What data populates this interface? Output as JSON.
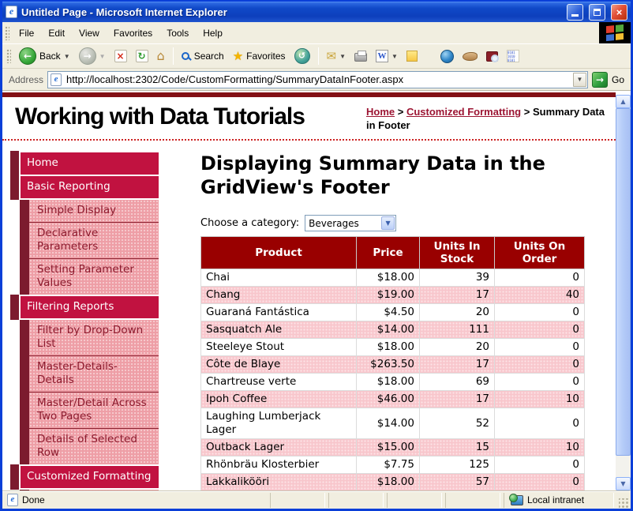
{
  "window": {
    "title": "Untitled Page - Microsoft Internet Explorer"
  },
  "menu": {
    "items": [
      "File",
      "Edit",
      "View",
      "Favorites",
      "Tools",
      "Help"
    ]
  },
  "toolbar": {
    "back_label": "Back",
    "search_label": "Search",
    "favorites_label": "Favorites"
  },
  "address": {
    "label": "Address",
    "value": "http://localhost:2302/Code/CustomFormatting/SummaryDataInFooter.aspx",
    "go_label": "Go"
  },
  "masthead": {
    "title": "Working with Data Tutorials",
    "separator": ">",
    "breadcrumb": [
      {
        "label": "Home",
        "link": true
      },
      {
        "label": "Customized Formatting",
        "link": true
      },
      {
        "label": "Summary Data in Footer",
        "link": false
      }
    ]
  },
  "sidebar": {
    "items": [
      {
        "label": "Home",
        "level": 1
      },
      {
        "label": "Basic Reporting",
        "level": 1
      },
      {
        "label": "Simple Display",
        "level": 2
      },
      {
        "label": "Declarative Parameters",
        "level": 2
      },
      {
        "label": "Setting Parameter Values",
        "level": 2
      },
      {
        "label": "Filtering Reports",
        "level": 1
      },
      {
        "label": "Filter by Drop-Down List",
        "level": 2
      },
      {
        "label": "Master-Details-Details",
        "level": 2
      },
      {
        "label": "Master/Detail Across Two Pages",
        "level": 2
      },
      {
        "label": "Details of Selected Row",
        "level": 2
      },
      {
        "label": "Customized Formatting",
        "level": 1
      }
    ]
  },
  "main": {
    "heading": "Displaying Summary Data in the GridView's Footer",
    "category_label": "Choose a category:",
    "category_value": "Beverages",
    "table": {
      "columns": [
        "Product",
        "Price",
        "Units In Stock",
        "Units On Order"
      ],
      "rows": [
        [
          "Chai",
          "$18.00",
          "39",
          "0"
        ],
        [
          "Chang",
          "$19.00",
          "17",
          "40"
        ],
        [
          "Guaraná Fantástica",
          "$4.50",
          "20",
          "0"
        ],
        [
          "Sasquatch Ale",
          "$14.00",
          "111",
          "0"
        ],
        [
          "Steeleye Stout",
          "$18.00",
          "20",
          "0"
        ],
        [
          "Côte de Blaye",
          "$263.50",
          "17",
          "0"
        ],
        [
          "Chartreuse verte",
          "$18.00",
          "69",
          "0"
        ],
        [
          "Ipoh Coffee",
          "$46.00",
          "17",
          "10"
        ],
        [
          "Laughing Lumberjack Lager",
          "$14.00",
          "52",
          "0"
        ],
        [
          "Outback Lager",
          "$15.00",
          "15",
          "10"
        ],
        [
          "Rhönbräu Klosterbier",
          "$7.75",
          "125",
          "0"
        ],
        [
          "Lakkalikööri",
          "$18.00",
          "57",
          "0"
        ]
      ]
    }
  },
  "statusbar": {
    "status": "Done",
    "zone": "Local intranet"
  },
  "colors": {
    "table_header_bg": "#990000",
    "row_pink": "#f8c6cc",
    "nav_crimson": "#c11240",
    "nav_maroon": "#7c1b2e",
    "nav_pink": "#ee9ea6",
    "link_red": "#9c1533",
    "top_bar_red": "#821015"
  }
}
